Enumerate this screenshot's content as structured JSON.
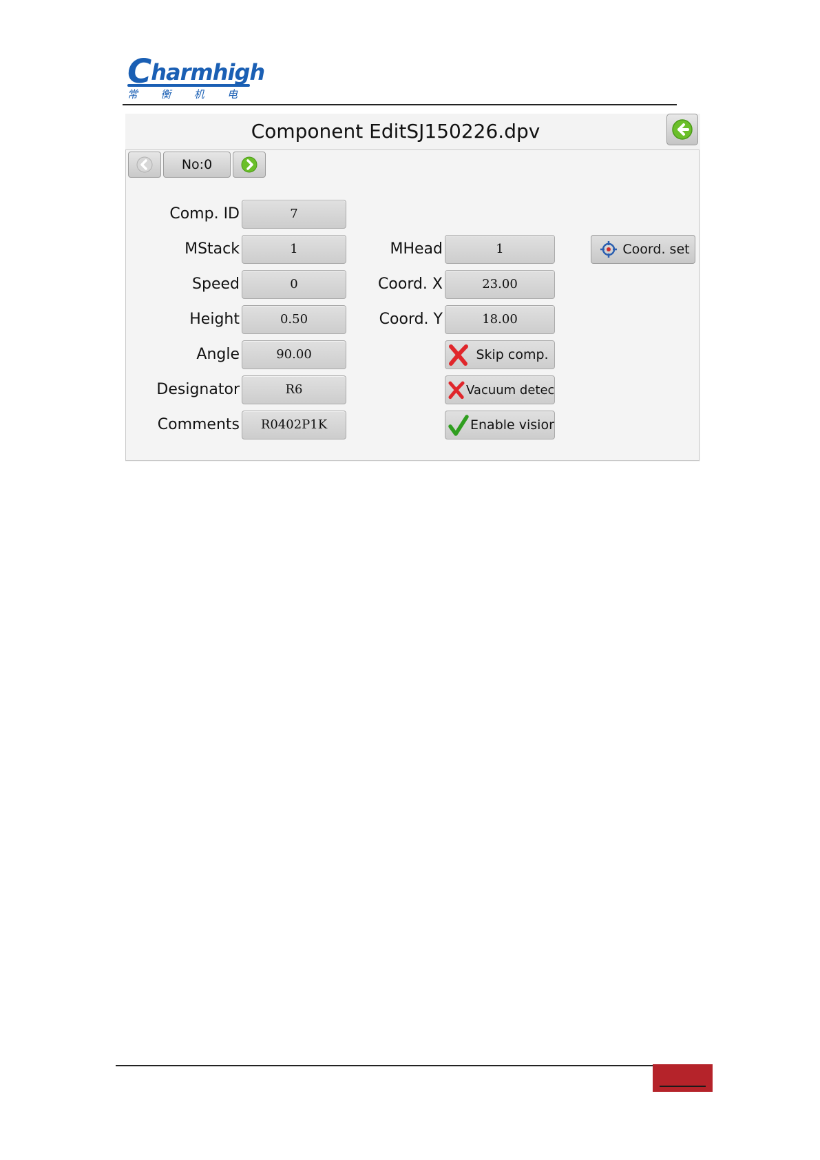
{
  "brand": {
    "logo_word_first": "C",
    "logo_word_rest": "harmhigh",
    "logo_chinese": [
      "常",
      "衡",
      "机",
      "电"
    ]
  },
  "screen": {
    "title": "Component EditSJ150226.dpv",
    "nav": {
      "record_label": "No:0"
    },
    "fields": {
      "comp_id": {
        "label": "Comp. ID",
        "value": "7"
      },
      "mstack": {
        "label": "MStack",
        "value": "1"
      },
      "speed": {
        "label": "Speed",
        "value": "0"
      },
      "height": {
        "label": "Height",
        "value": "0.50"
      },
      "angle": {
        "label": "Angle",
        "value": "90.00"
      },
      "designator": {
        "label": "Designator",
        "value": "R6"
      },
      "comments": {
        "label": "Comments",
        "value": "R0402P1K"
      },
      "mhead": {
        "label": "MHead",
        "value": "1"
      },
      "coord_x": {
        "label": "Coord. X",
        "value": "23.00"
      },
      "coord_y": {
        "label": "Coord. Y",
        "value": "18.00"
      }
    },
    "toggles": {
      "skip_comp": {
        "label": "Skip comp.",
        "state": "off",
        "icon": "red-x-icon"
      },
      "vacuum_detect": {
        "label": "Vacuum detect.",
        "state": "off",
        "icon": "red-x-icon"
      },
      "enable_vision": {
        "label": "Enable vision",
        "state": "on",
        "icon": "green-check-icon"
      }
    },
    "coord_set_label": "Coord. set"
  },
  "colors": {
    "brand_blue": "#1a5fb4",
    "green_icon": "#6bbf2a",
    "red_x": "#e0262b",
    "footer_red": "#b5232a"
  }
}
